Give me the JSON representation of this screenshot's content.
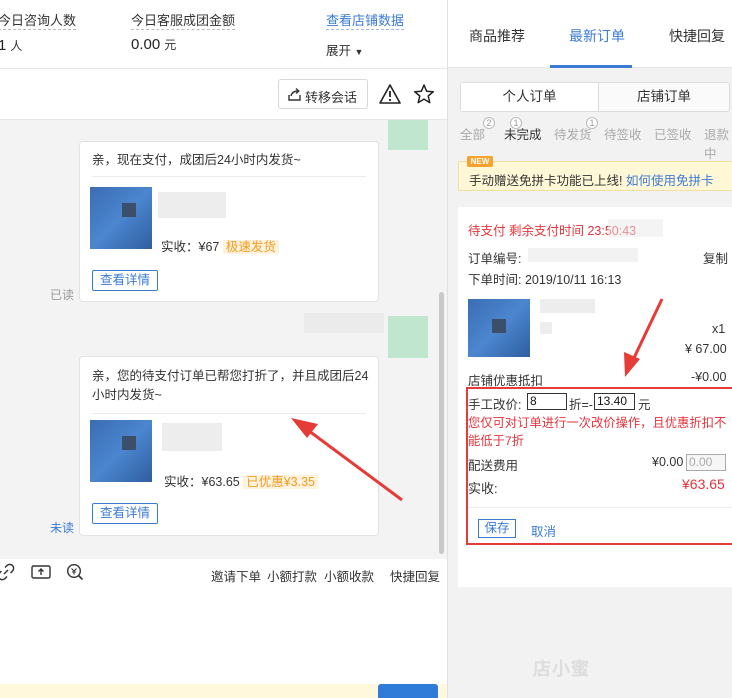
{
  "stats": {
    "consult_label": "今日咨询人数",
    "consult_value": "1",
    "consult_unit": "人",
    "amount_label": "今日客服成团金额",
    "amount_value": "0.00",
    "amount_unit": "元",
    "shop_data_link": "查看店铺数据",
    "expand_label": "展开"
  },
  "toolbar": {
    "transfer_label": "转移会话"
  },
  "messages": [
    {
      "text": "亲，现在支付，成团后24小时内发货~",
      "price_label": "实收：¥67",
      "tag": "极速发货",
      "detail_button": "查看详情",
      "status": "已读"
    },
    {
      "text_line1": "亲，您的待支付订单已帮您打折了，并且成团后24",
      "text_line2": "小时内发货~",
      "price_label": "实收：¥63.65",
      "tag": "已优惠¥3.35",
      "detail_button": "查看详情",
      "status": "未读"
    }
  ],
  "bottom_tools": {
    "invite": "邀请下单",
    "small_pay": "小额打款",
    "small_collect": "小额收款",
    "quick_reply": "快捷回复"
  },
  "right_tabs": [
    "商品推荐",
    "最新订单",
    "快捷回复"
  ],
  "segments": [
    "个人订单",
    "店铺订单"
  ],
  "filters": [
    {
      "label": "全部",
      "badge": "2"
    },
    {
      "label": "未完成",
      "badge": ""
    },
    {
      "label": "待发货",
      "badge": "1"
    },
    {
      "label": "待签收",
      "badge": "1"
    },
    {
      "label": "已签收",
      "badge": ""
    },
    {
      "label": "退款中",
      "badge": ""
    }
  ],
  "notice": {
    "tag": "NEW",
    "text": "手动赠送免拼卡功能已上线!",
    "link": "如何使用免拼卡"
  },
  "order": {
    "status": "待支付 剩余支付时间 23:50:43",
    "order_no_label": "订单编号:",
    "copy_label": "复制",
    "time_label": "下单时间:",
    "time_value": "2019/10/11 16:13",
    "qty": "x1",
    "price": "¥ 67.00",
    "coupon_label": "店铺优惠抵扣",
    "coupon_value": "-¥0.00",
    "manual_label": "手工改价:",
    "discount_value": "8",
    "discount_suffix": "折=-",
    "amount_value": "13.40",
    "amount_suffix": "元",
    "warning_line1": "您仅可对订单进行一次改价操作，且优惠折扣不",
    "warning_line2": "能低于7折",
    "shipping_label": "配送费用",
    "shipping_value": "¥0.00",
    "shipping_input": "0.00",
    "final_label": "实收:",
    "final_value": "¥63.65",
    "save_label": "保存",
    "cancel_label": "取消"
  },
  "watermark": "店小蜜",
  "colors": {
    "accent": "#3b7bd4",
    "highlight_red": "#e53c37",
    "tag_orange": "#f29b1e"
  }
}
